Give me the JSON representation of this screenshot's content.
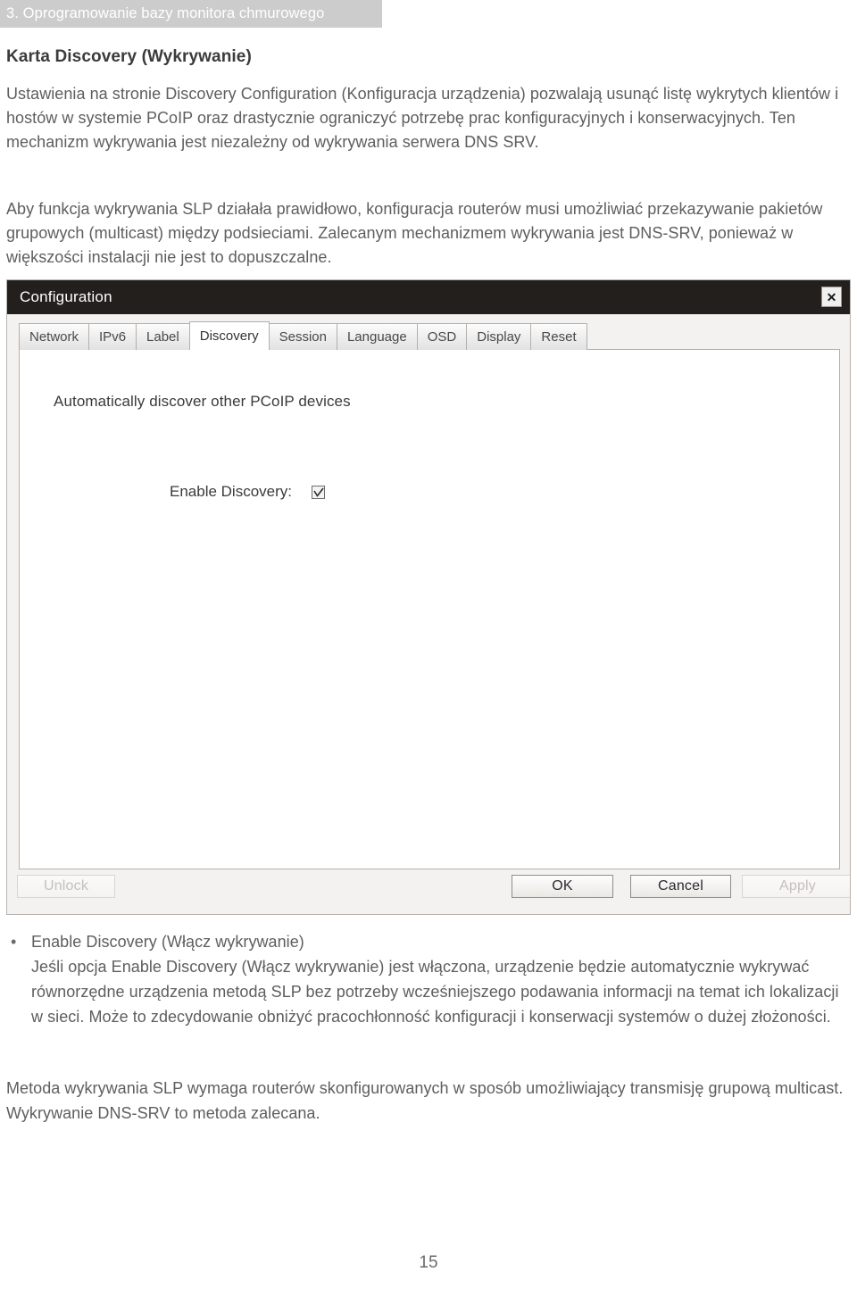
{
  "page": {
    "running_header": "3. Oprogramowanie bazy monitora chmurowego",
    "heading": "Karta Discovery (Wykrywanie)",
    "page_number": "15"
  },
  "body": {
    "intro_paragraph": "Ustawienia na stronie Discovery Configuration (Konfiguracja urządzenia) pozwalają usunąć listę wykrytych klientów i hostów w systemie PCoIP oraz drastycznie ograniczyć potrzebę prac konfiguracyjnych i konserwacyjnych. Ten mechanizm wykrywania jest niezależny od wykrywania serwera DNS SRV.",
    "slp_paragraph": "Aby funkcja wykrywania SLP działała prawidłowo, konfiguracja routerów musi umożliwiać przekazywanie pakietów grupowych (multicast) między podsieciami. Zalecanym mechanizmem wykrywania jest DNS-SRV, ponieważ w większości instalacji nie jest to dopuszczalne.",
    "closing_paragraph": "Metoda wykrywania SLP wymaga routerów skonfigurowanych w sposób umożliwiający transmisję grupową multicast. Wykrywanie DNS-SRV to metoda zalecana."
  },
  "bullets": [
    {
      "marker": "•",
      "title": "Enable Discovery (Włącz wykrywanie)",
      "description": "Jeśli opcja Enable Discovery (Włącz wykrywanie) jest włączona, urządzenie będzie automatycznie wykrywać równorzędne urządzenia metodą SLP bez potrzeby wcześniejszego podawania informacji na temat ich lokalizacji w sieci. Może to zdecydowanie obniżyć pracochłonność konfiguracji i konserwacji systemów o dużej złożoności."
    }
  ],
  "dialog": {
    "title": "Configuration",
    "close_label": "✕",
    "tabs": [
      {
        "label": "Network",
        "active": false
      },
      {
        "label": "IPv6",
        "active": false
      },
      {
        "label": "Label",
        "active": false
      },
      {
        "label": "Discovery",
        "active": true
      },
      {
        "label": "Session",
        "active": false
      },
      {
        "label": "Language",
        "active": false
      },
      {
        "label": "OSD",
        "active": false
      },
      {
        "label": "Display",
        "active": false
      },
      {
        "label": "Reset",
        "active": false
      }
    ],
    "panel": {
      "heading": "Automatically discover other PCoIP devices",
      "field_label": "Enable Discovery:",
      "checkbox_checked": true
    },
    "footer": {
      "unlock_label": "Unlock",
      "ok_label": "OK",
      "cancel_label": "Cancel",
      "apply_label": "Apply"
    }
  },
  "colors": {
    "band_bg": "#cccccc",
    "titlebar_bg": "#221f1d",
    "dialog_bg": "#f4f2f0",
    "text": "#5e5e5e"
  }
}
